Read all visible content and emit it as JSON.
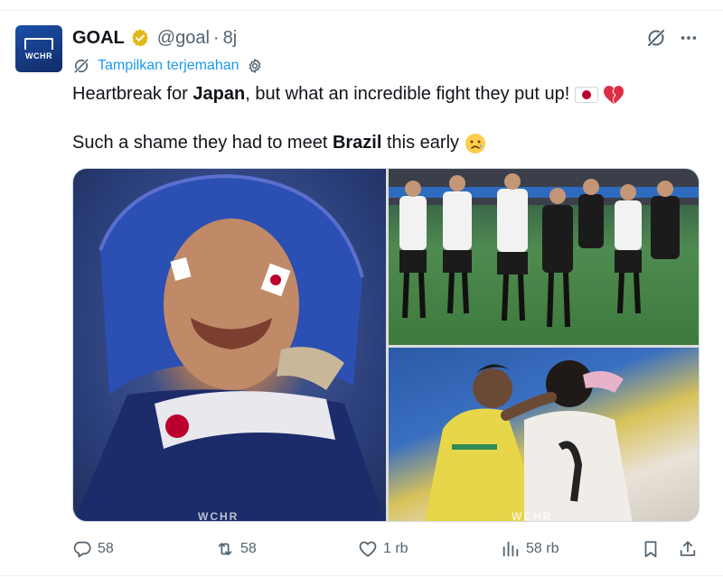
{
  "author": {
    "name": "GOAL",
    "handle": "@goal",
    "separator": "·",
    "time": "8j",
    "avatar_text": "WCHR"
  },
  "translate": {
    "label": "Tampilkan terjemahan"
  },
  "tweet": {
    "line1_pre": "Heartbreak for ",
    "line1_bold": "Japan",
    "line1_post": ", but what an incredible fight they put up! ",
    "line2_pre": "Such a shame they had to meet ",
    "line2_bold": "Brazil",
    "line2_post": " this early "
  },
  "media": {
    "watermark_left": "WCHR",
    "watermark_right": "WCHR"
  },
  "actions": {
    "replies": "58",
    "reposts": "58",
    "likes": "1 rb",
    "views": "58 rb"
  },
  "icons": {
    "verified": "verified-badge-icon",
    "grok": "grok-icon",
    "more": "more-icon",
    "translate": "translate-icon",
    "settings": "gear-icon",
    "reply": "reply-icon",
    "repost": "repost-icon",
    "like": "heart-icon",
    "views": "views-icon",
    "bookmark": "bookmark-icon",
    "share": "share-icon"
  },
  "colors": {
    "accent": "#1d9bf0",
    "muted": "#536471",
    "text": "#0f1419",
    "verified_gold": "#e2b719"
  }
}
